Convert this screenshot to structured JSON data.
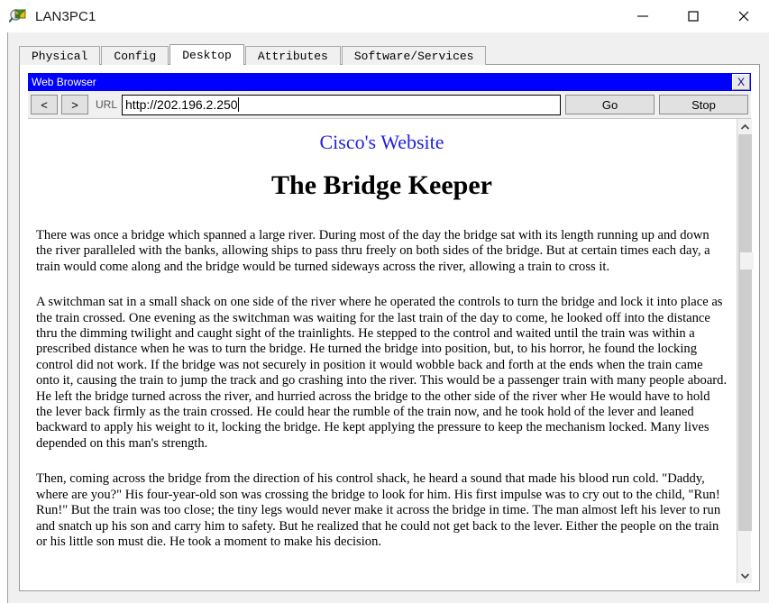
{
  "window": {
    "title": "LAN3PC1",
    "icon": "device-inspect-icon",
    "controls": [
      {
        "name": "minimize-button",
        "glyph": "minimize"
      },
      {
        "name": "maximize-button",
        "glyph": "maximize"
      },
      {
        "name": "close-button",
        "glyph": "close"
      }
    ]
  },
  "tabs": [
    {
      "label": "Physical",
      "active": false
    },
    {
      "label": "Config",
      "active": false
    },
    {
      "label": "Desktop",
      "active": true
    },
    {
      "label": "Attributes",
      "active": false
    },
    {
      "label": "Software/Services",
      "active": false
    }
  ],
  "browser": {
    "title": "Web Browser",
    "close_label": "X",
    "back_label": "<",
    "forward_label": ">",
    "url_label": "URL",
    "url_value": "http://202.196.2.250",
    "url_placeholder": "http://",
    "go_label": "Go",
    "stop_label": "Stop",
    "accent_color": "#0000ff"
  },
  "page": {
    "site_title": "Cisco's Website",
    "site_title_color": "#2222dd",
    "heading": "The Bridge Keeper",
    "paragraphs": [
      "There was once a bridge which spanned a large river. During most of the day the bridge sat with its length running up and down the river paralleled with the banks, allowing ships to pass thru freely on both sides of the bridge. But at certain times each day, a train would come along and the bridge would be turned sideways across the river, allowing a train to cross it.",
      "A switchman sat in a small shack on one side of the river where he operated the controls to turn the bridge and lock it into place as the train crossed. One evening as the switchman was waiting for the last train of the day to come, he looked off into the distance thru the dimming twilight and caught sight of the trainlights. He stepped to the control and waited until the train was within a prescribed distance when he was to turn the bridge. He turned the bridge into position, but, to his horror, he found the locking control did not work. If the bridge was not securely in position it would wobble back and forth at the ends when the train came onto it, causing the train to jump the track and go crashing into the river. This would be a passenger train with many people aboard. He left the bridge turned across the river, and hurried across the bridge to the other side of the river wher He would have to hold the lever back firmly as the train crossed. He could hear the rumble of the train now, and he took hold of the lever and leaned backward to apply his weight to it, locking the bridge. He kept applying the pressure to keep the mechanism locked. Many lives depended on this man's strength.",
      "Then, coming across the bridge from the direction of his control shack, he heard a sound that made his blood run cold. \"Daddy, where are you?\" His four-year-old son was crossing the bridge to look for him. His first impulse was to cry out to the child, \"Run! Run!\" But the train was too close; the tiny legs would never make it across the bridge in time. The man almost left his lever to run and snatch up his son and carry him to safety. But he realized that he could not get back to the lever. Either the people on the train or his little son must die. He took a moment to make his decision."
    ]
  },
  "scrollbar": {
    "up_arrow": "chevron-up-icon",
    "down_arrow": "chevron-down-icon"
  }
}
